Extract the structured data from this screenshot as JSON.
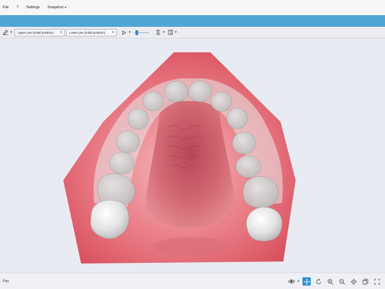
{
  "menu": [
    {
      "label": "File",
      "caret": ""
    },
    {
      "label": "?",
      "caret": ""
    },
    {
      "label": "Settings",
      "caret": ""
    },
    {
      "label": "Snapshot",
      "caret": "▾"
    }
  ],
  "toolbar": {
    "upper_jaw": "Upper jaw (initial position)",
    "lower_jaw": "Lower jaw (initial position)",
    "caret": "▾",
    "playback_level": 0.1
  },
  "status": {
    "mode": "Pan"
  },
  "colors": {
    "accent": "#4fa6d6",
    "gum": "#e6616a",
    "tooth": "#e2e2e2",
    "background": "#e9ebf2"
  },
  "icons": {
    "toolbar": [
      "pen-icon",
      "play-icon",
      "filter-icon",
      "layout-icon"
    ],
    "bottom": [
      "eye-icon",
      "pan-icon",
      "rotate-icon",
      "zoom-in-icon",
      "zoom-out-icon",
      "target-icon",
      "copy-icon",
      "fullscreen-icon"
    ]
  }
}
